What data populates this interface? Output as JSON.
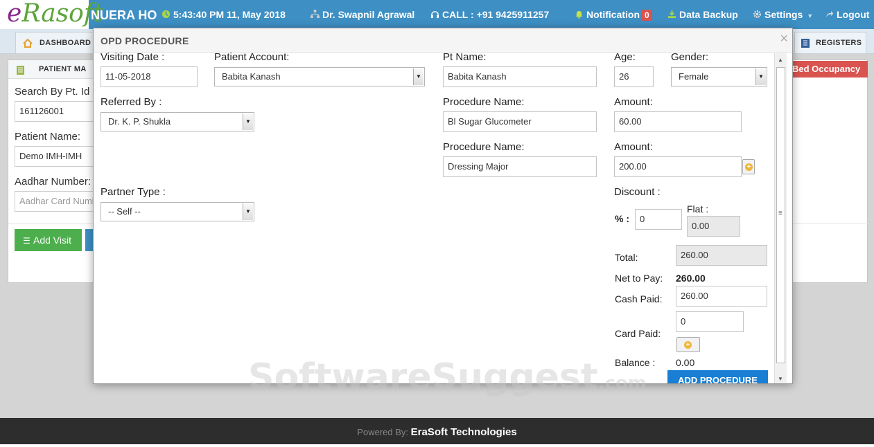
{
  "header": {
    "logo_text_1": "e",
    "logo_text_2": "Rasoft",
    "hospital_name": "NUERA HO",
    "datetime": "5:43:40 PM 11, May 2018",
    "user": "Dr. Swapnil Agrawal",
    "call": "CALL : +91 9425911257",
    "notification_label": "Notification",
    "notification_count": "0",
    "data_backup": "Data Backup",
    "settings": "Settings",
    "logout": "Logout"
  },
  "nav": {
    "dashboard": "DASHBOARD",
    "registers": "REGISTERS"
  },
  "background_page": {
    "panel_title": "PATIENT MA",
    "search_label": "Search By Pt. Id",
    "search_value": "161126001",
    "patient_name_label": "Patient Name:",
    "patient_name_value": "Demo IMH-IMH",
    "aadhar_label": "Aadhar Number:",
    "aadhar_placeholder": "Aadhar Card Numb",
    "add_visit": "Add Visit",
    "bed_occupancy": "Bed Occupancy"
  },
  "modal": {
    "title": "OPD PROCEDURE",
    "close": "×",
    "visiting_date_label": "Visiting Date :",
    "visiting_date": "11-05-2018",
    "patient_account_label": "Patient Account:",
    "patient_account": "Babita Kanash",
    "pt_name_label": "Pt Name:",
    "pt_name": "Babita Kanash",
    "age_label": "Age:",
    "age": "26",
    "gender_label": "Gender:",
    "gender": "Female",
    "referred_by_label": "Referred By :",
    "referred_by": "Dr. K. P. Shukla",
    "procedures": [
      {
        "name_label": "Procedure Name:",
        "name": "Bl Sugar Glucometer",
        "amount_label": "Amount:",
        "amount": "60.00"
      },
      {
        "name_label": "Procedure Name:",
        "name": "Dressing Major",
        "amount_label": "Amount:",
        "amount": "200.00"
      }
    ],
    "partner_type_label": "Partner Type :",
    "partner_type": "-- Self --",
    "discount_label": "Discount :",
    "percent_label": "% :",
    "percent_value": "0",
    "flat_label": "Flat :",
    "flat_value": "0.00",
    "total_label": "Total:",
    "total_value": "260.00",
    "net_to_pay_label": "Net to Pay:",
    "net_to_pay_value": "260.00",
    "cash_paid_label": "Cash Paid:",
    "cash_paid_value": "260.00",
    "card_paid_label": "Card Paid:",
    "card_paid_value": "0",
    "balance_label": "Balance :",
    "balance_value": "0.00",
    "add_procedure": "ADD PROCEDURE"
  },
  "footer": {
    "powered_by": "Powered By:",
    "company": "EraSoft Technologies"
  },
  "watermark": {
    "main": "SoftwareSuggest",
    "suffix": ".com"
  },
  "colors": {
    "topbar": "#3d8fc4",
    "add_visit": "#4cae4c",
    "bed_occupancy": "#d9534f",
    "add_procedure": "#1a7fd4",
    "footer": "#2d2d2d"
  }
}
